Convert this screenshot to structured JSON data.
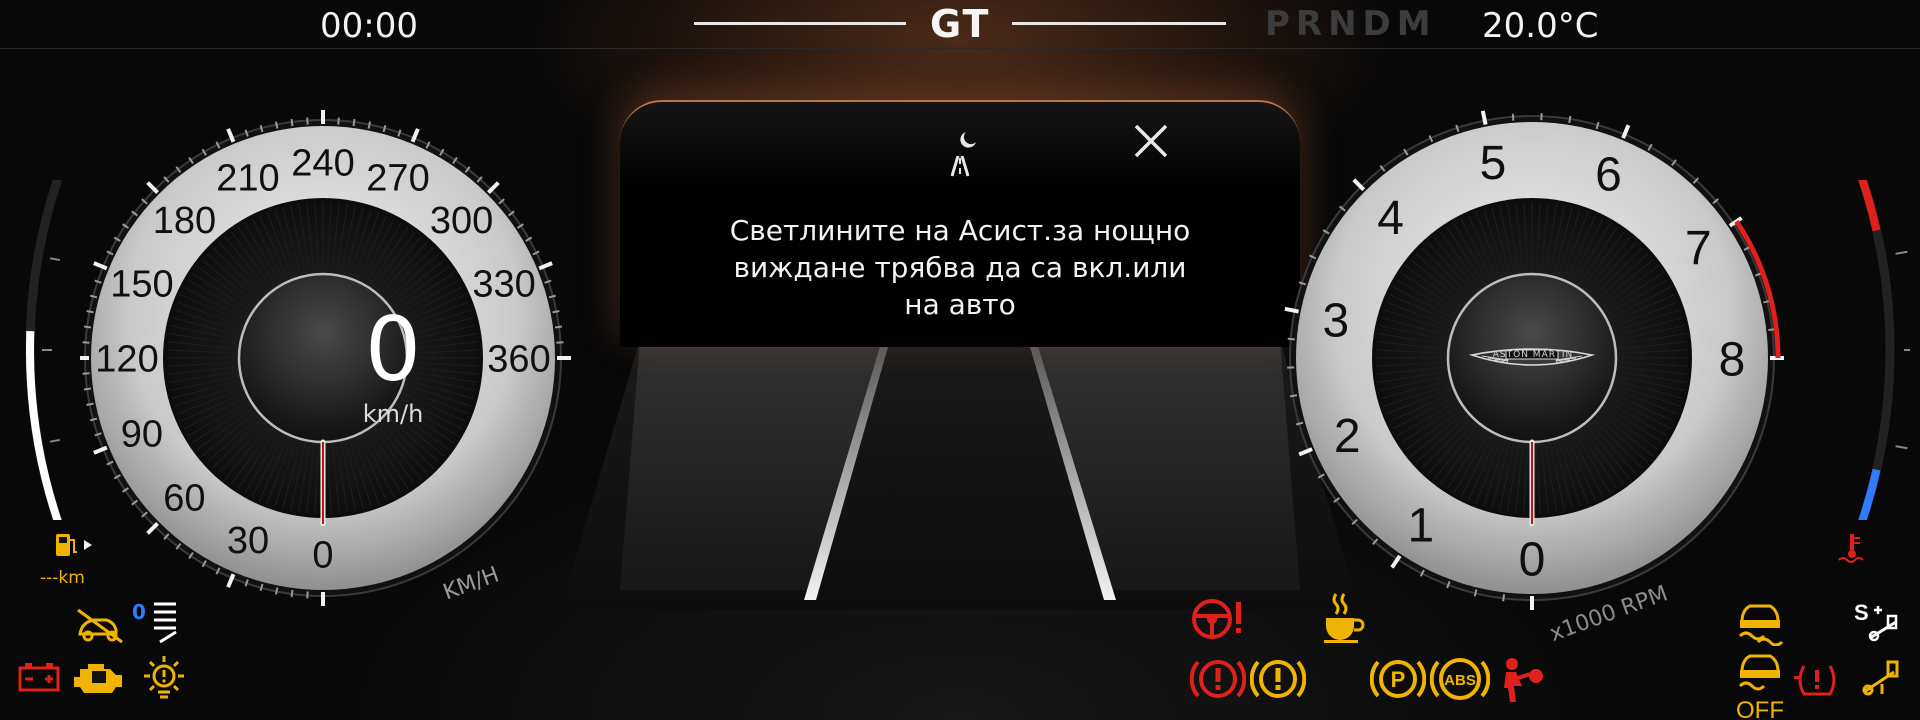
{
  "topbar": {
    "clock": "00:00",
    "mode": "GT",
    "gear": "PRNDM",
    "temperature": "20.0°C"
  },
  "speedometer": {
    "speed": "0",
    "speed_unit": "km/h",
    "scale_label": "KM/H",
    "ticks": [
      "0",
      "30",
      "60",
      "90",
      "120",
      "150",
      "180",
      "210",
      "240",
      "270",
      "300",
      "330",
      "360"
    ],
    "needle_value_fraction": 0
  },
  "tachometer": {
    "scale_label": "x1000 RPM",
    "ticks": [
      "0",
      "1",
      "2",
      "3",
      "4",
      "5",
      "6",
      "7",
      "8"
    ],
    "redline_start": 7,
    "needle_value_fraction": 0,
    "logo_text": "ASTON MARTIN"
  },
  "fuel": {
    "range": "---km",
    "level_fraction": 0.55
  },
  "coolant": {
    "level_fraction": 0.0
  },
  "notification": {
    "message": "Светлините на Асист.за нощно виждане трябва да са вкл.или на авто",
    "icon": "night-vision-icon",
    "close_icon": "close-icon"
  },
  "warning_lights": {
    "left": [
      "passenger-airbag-off-icon",
      "headlight-level-icon",
      "battery-icon",
      "engine-check-icon",
      "exterior-light-fault-icon"
    ],
    "headlight_level": "0",
    "center": [
      "steering-warning-icon",
      "brake-warning-icon",
      "general-warning-icon",
      "coffee-break-icon",
      "parking-brake-icon",
      "abs-icon",
      "airbag-icon"
    ],
    "right": [
      "traction-control-icon",
      "traction-control-off-icon",
      "tire-pressure-icon",
      "stop-start-icon",
      "stop-start-off-icon"
    ],
    "tc_off_label": "OFF",
    "stop_start_label": "S",
    "colors": {
      "red": "#e0201a",
      "amber": "#f0b400",
      "white": "#ffffff",
      "blue": "#2f7cff"
    }
  }
}
